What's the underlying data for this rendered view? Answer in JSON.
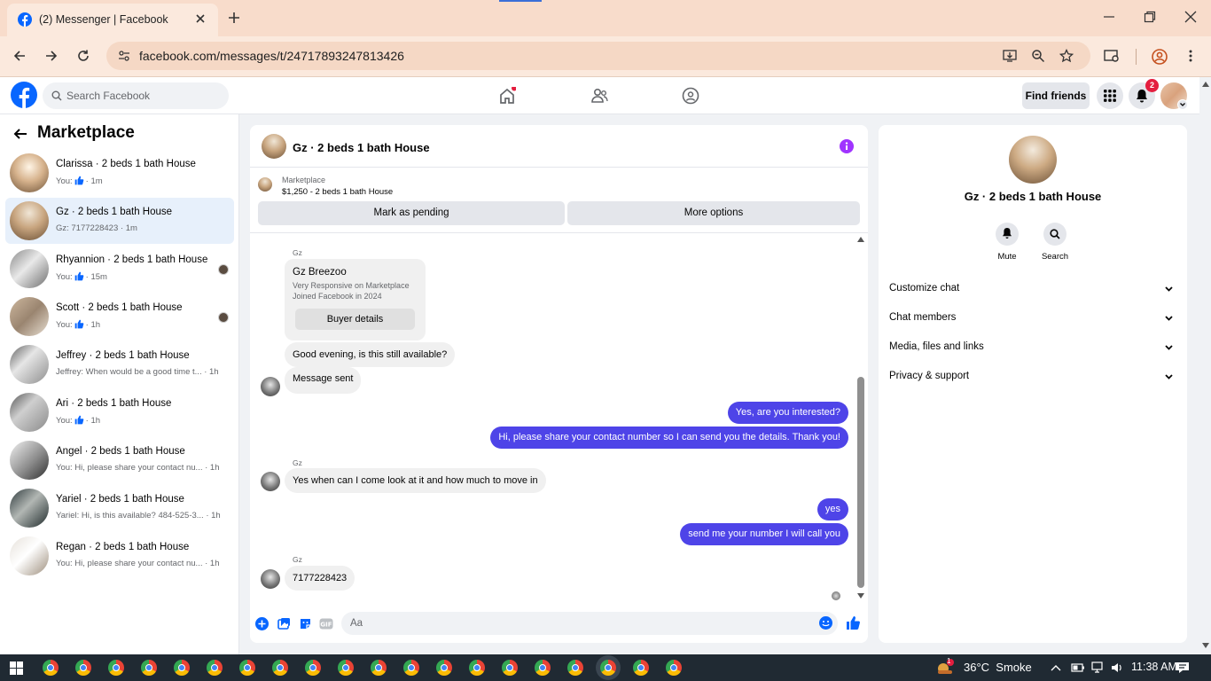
{
  "browser": {
    "tab_title": "(2) Messenger | Facebook",
    "url": "facebook.com/messages/t/24717893247813426"
  },
  "fbnav": {
    "search_placeholder": "Search Facebook",
    "find_friends": "Find friends",
    "notif_count": "2"
  },
  "sidebar": {
    "title": "Marketplace",
    "conversations": [
      {
        "name": "Clarissa · 2 beds 1 bath House",
        "prefix": "You:",
        "thumb": true,
        "suffix": "· 1m",
        "text": ""
      },
      {
        "name": "Gz · 2 beds 1 bath House",
        "prefix": "",
        "thumb": false,
        "suffix": "",
        "text": "Gz: 7177228423 · 1m"
      },
      {
        "name": "Rhyannion · 2 beds 1 bath House",
        "prefix": "You:",
        "thumb": true,
        "suffix": "· 15m",
        "text": ""
      },
      {
        "name": "Scott · 2 beds 1 bath House",
        "prefix": "You:",
        "thumb": true,
        "suffix": "· 1h",
        "text": ""
      },
      {
        "name": "Jeffrey · 2 beds 1 bath House",
        "prefix": "",
        "thumb": false,
        "suffix": "",
        "text": "Jeffrey: When would be a good time t... · 1h"
      },
      {
        "name": "Ari · 2 beds 1 bath House",
        "prefix": "You:",
        "thumb": true,
        "suffix": "· 1h",
        "text": ""
      },
      {
        "name": "Angel · 2 beds 1 bath House",
        "prefix": "",
        "thumb": false,
        "suffix": "",
        "text": "You: Hi, please share your contact nu... · 1h"
      },
      {
        "name": "Yariel · 2 beds 1 bath House",
        "prefix": "",
        "thumb": false,
        "suffix": "",
        "text": "Yariel: Hi, is this available? 484-525-3... · 1h"
      },
      {
        "name": "Regan · 2 beds 1 bath House",
        "prefix": "",
        "thumb": false,
        "suffix": "",
        "text": "You: Hi, please share your contact nu... · 1h"
      }
    ]
  },
  "chat": {
    "title": "Gz · 2 beds 1 bath House",
    "marketplace_label": "Marketplace",
    "listing": "$1,250 - 2 beds 1 bath House",
    "mark_pending": "Mark as pending",
    "more_options": "More options",
    "buyer_card": {
      "sender": "Gz",
      "name": "Gz Breezoo",
      "line1": "Very Responsive on Marketplace",
      "line2": "Joined Facebook in 2024",
      "button": "Buyer details"
    },
    "messages": {
      "m1": "Good evening, is this still available?",
      "m2": "Message sent",
      "m3": "Yes, are you interested?",
      "m4": "Hi, please share your contact number so I can send you the details. Thank you!",
      "m5_sender": "Gz",
      "m5": "Yes when can I come look at it and how much to move in",
      "m6": "yes",
      "m7": "send me your number I will call you",
      "m8_sender": "Gz",
      "m8": "7177228423"
    },
    "composer_placeholder": "Aa"
  },
  "info": {
    "name": "Gz · 2 beds 1 bath House",
    "mute": "Mute",
    "search": "Search",
    "rows": [
      "Customize chat",
      "Chat members",
      "Media, files and links",
      "Privacy & support"
    ]
  },
  "taskbar": {
    "weather": "36°C  Smoke",
    "time": "11:38 AM",
    "weather_badge": "1"
  },
  "colors": {
    "accent": "#4e44e8",
    "fb_blue": "#0866ff",
    "info_purple": "#a033ff"
  }
}
